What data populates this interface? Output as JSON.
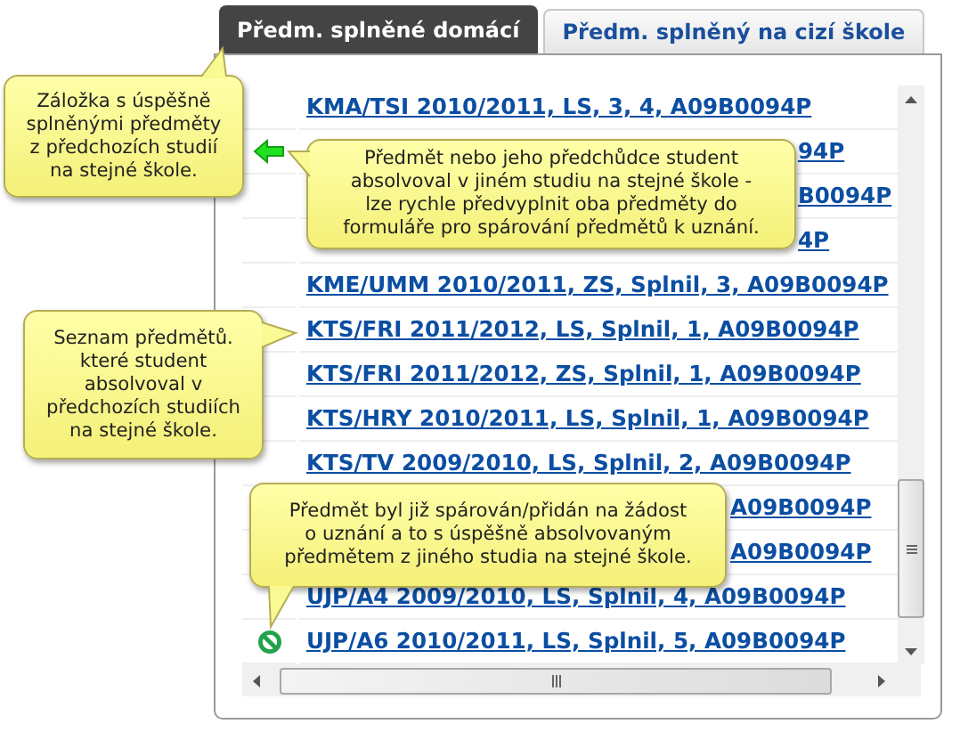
{
  "tabs": [
    {
      "label": "Předm. splněné domácí",
      "selected": true
    },
    {
      "label": "Předm. splněný na cizí škole",
      "selected": false
    }
  ],
  "rows": [
    {
      "kind": "link",
      "text": "KMA/TSI 2010/2011, LS, 3, 4, A09B0094P"
    },
    {
      "kind": "covered",
      "text": "94P",
      "can_prefill": true
    },
    {
      "kind": "covered",
      "text": "B0094P"
    },
    {
      "kind": "covered",
      "text": "4P"
    },
    {
      "kind": "link",
      "text": "KME/UMM 2010/2011, ZS, Splnil, 3, A09B0094P"
    },
    {
      "kind": "link",
      "text": "KTS/FRI 2011/2012, LS, Splnil, 1, A09B0094P"
    },
    {
      "kind": "link",
      "text": "KTS/FRI 2011/2012, ZS, Splnil, 1, A09B0094P"
    },
    {
      "kind": "link",
      "text": "KTS/HRY 2010/2011, LS, Splnil, 1, A09B0094P"
    },
    {
      "kind": "link",
      "text": "KTS/TV 2009/2010, LS, Splnil, 2, A09B0094P"
    },
    {
      "kind": "covered",
      "text": "A09B0094P"
    },
    {
      "kind": "covered",
      "text": "A09B0094P"
    },
    {
      "kind": "link",
      "text": "UJP/A4 2009/2010, LS, Splnil, 4, A09B0094P"
    },
    {
      "kind": "link",
      "text": "UJP/A6 2010/2011, LS, Splnil, 5, A09B0094P",
      "already_paired": true
    }
  ],
  "callouts": [
    {
      "text": "Záložka s úspěšně\nsplněnými předměty\nz předchozích studií\nna stejné škole."
    },
    {
      "text": "Předmět nebo jeho předchůdce student\nabsolvoval v jiném studiu na stejné škole -\nlze rychle předvyplnit oba předměty do\nformuláře pro spárování předmětů k uznání."
    },
    {
      "text": "Seznam předmětů.\nkteré student\nabsolvoval v\npředchozích studiích\nna stejné škole."
    },
    {
      "text": "Předmět byl již spárován/přidán na žádost\no uznání a to s úspěšně absolvovaným\npředmětem z jiného studia na stejné škole."
    }
  ]
}
